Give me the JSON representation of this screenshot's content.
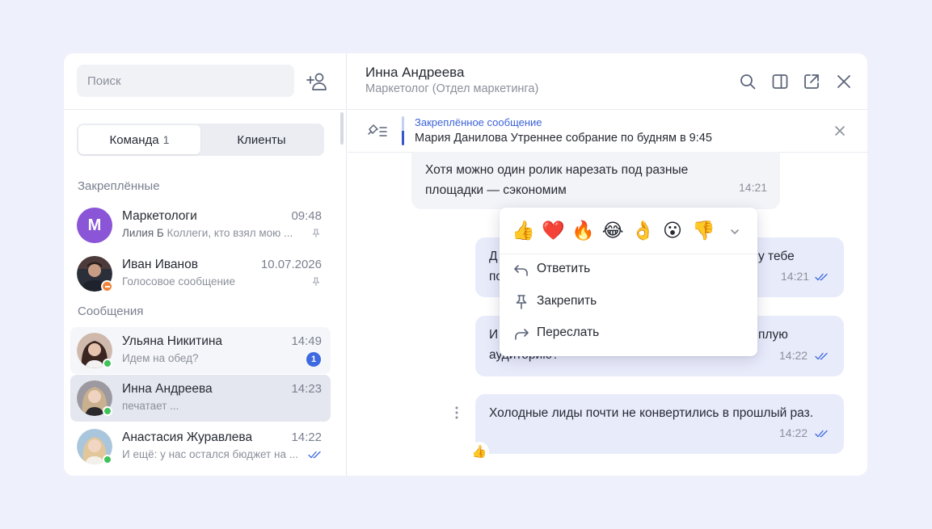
{
  "search": {
    "placeholder": "Поиск"
  },
  "tabs": [
    {
      "label": "Команда",
      "count": "1"
    },
    {
      "label": "Клиенты"
    }
  ],
  "sections": {
    "pinned": "Закреплённые",
    "messages": "Сообщения"
  },
  "pinned_chats": [
    {
      "name": "Маркетологи",
      "avatar_letter": "M",
      "time": "09:48",
      "sender": "Лилия Б",
      "preview": "Коллеги, кто взял мою ..."
    },
    {
      "name": "Иван Иванов",
      "time": "10.07.2026",
      "preview": "Голосовое сообщение"
    }
  ],
  "chats": [
    {
      "name": "Ульяна Никитина",
      "time": "14:49",
      "preview": "Идем на обед?",
      "unread": "1"
    },
    {
      "name": "Инна Андреева",
      "time": "14:23",
      "preview": "печатает ..."
    },
    {
      "name": "Анастасия Журавлева",
      "time": "14:22",
      "preview": "И ещё: у нас остался бюджет на ..."
    }
  ],
  "header": {
    "name": "Инна Андреева",
    "role": "Маркетолог (Отдел маркетинга)"
  },
  "pinned_message": {
    "title": "Закреплённое сообщение",
    "author": "Мария Данилова",
    "text": "Утреннее собрание по будням в 9:45"
  },
  "messages": [
    {
      "text": "Хотя можно один ролик нарезать под разные площадки — сэкономим",
      "time": "14:21"
    },
    {
      "text_left": "Д",
      "text_right": "у тебе",
      "text_left2": "по",
      "time": "14:21"
    },
    {
      "text_left": "И",
      "text_right": "плую",
      "text_left2": "аудиторию?",
      "time": "14:22"
    },
    {
      "text": "Холодные лиды почти не конвертились в прошлый раз.",
      "time": "14:22",
      "reaction": "👍"
    }
  ],
  "context_menu": {
    "emojis": [
      "👍",
      "❤️",
      "🔥",
      "😂",
      "👌",
      "😮",
      "👎"
    ],
    "items": [
      {
        "label": "Ответить",
        "icon": "reply-icon"
      },
      {
        "label": "Закрепить",
        "icon": "pin-icon"
      },
      {
        "label": "Переслать",
        "icon": "forward-icon"
      }
    ]
  },
  "colors": {
    "accent": "#3d6ae0",
    "outgoing_bubble": "#e8ebfa",
    "incoming_bubble": "#f3f4f8",
    "page_bg": "#eef0fb",
    "online": "#3fc25a"
  }
}
